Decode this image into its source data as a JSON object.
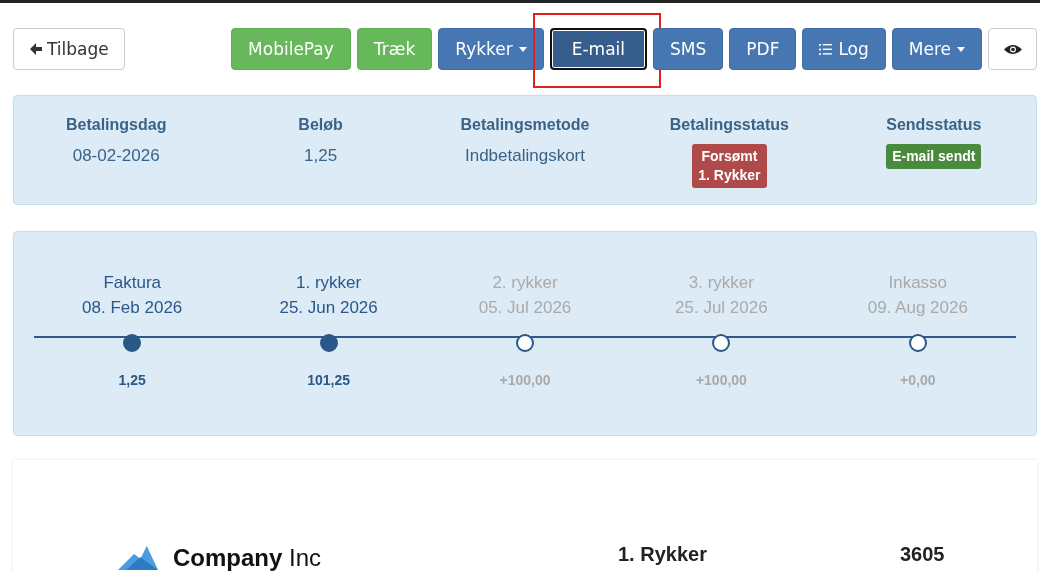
{
  "toolbar": {
    "back_button": {
      "label": "Tilbage"
    },
    "buttons": [
      {
        "label": "MobilePay",
        "kind": "success"
      },
      {
        "label": "Træk",
        "kind": "success"
      },
      {
        "label": "Rykker",
        "kind": "menu"
      },
      {
        "label": "E-mail",
        "kind": "current"
      },
      {
        "label": "SMS",
        "kind": "primary"
      },
      {
        "label": "PDF",
        "kind": "primary"
      },
      {
        "label": "Log",
        "kind": "log"
      },
      {
        "label": "Mere",
        "kind": "menu"
      },
      {
        "kind": "preview"
      }
    ]
  },
  "summary": [
    {
      "heading": "Betalingsdag",
      "value": "08-02-2026",
      "kind": "text"
    },
    {
      "heading": "Beløb",
      "value": "1,25",
      "kind": "text"
    },
    {
      "heading": "Betalingsmetode",
      "value": "Indbetalingskort",
      "kind": "text"
    },
    {
      "heading": "Betalingsstatus",
      "value": "Forsømt\n1. Rykker",
      "kind": "badge",
      "color": "#b04a4a"
    },
    {
      "heading": "Sendsstatus",
      "value": "E-mail sendt",
      "kind": "badge",
      "color": "#4a8a3f"
    }
  ],
  "timeline": [
    {
      "title": "Faktura",
      "date": "08. Feb 2026",
      "amount": "1,25",
      "reached": true
    },
    {
      "title": "1. rykker",
      "date": "25. Jun 2026",
      "amount": "101,25",
      "reached": true
    },
    {
      "title": "2. rykker",
      "date": "05. Jul 2026",
      "amount": "+100,00",
      "reached": false
    },
    {
      "title": "3. rykker",
      "date": "25. Jul 2026",
      "amount": "+100,00",
      "reached": false
    },
    {
      "title": "Inkasso",
      "date": "09. Aug 2026",
      "amount": "+0,00",
      "reached": false
    }
  ],
  "document": {
    "company_name": "Company",
    "company_suffix": "Inc",
    "title": "1. Rykker",
    "number": "3605"
  }
}
